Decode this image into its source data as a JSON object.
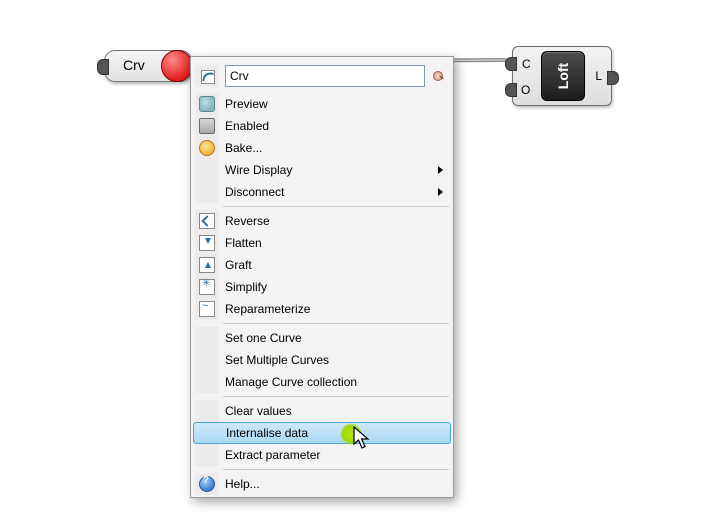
{
  "canvas": {
    "crv_param": {
      "label": "Crv",
      "state": "error"
    },
    "loft": {
      "label": "Loft",
      "inputs": [
        "C",
        "O"
      ],
      "outputs": [
        "L"
      ]
    }
  },
  "context_menu": {
    "name_field": "Crv",
    "sections": [
      {
        "items": [
          {
            "id": "preview",
            "label": "Preview",
            "icon": "preview-icon"
          },
          {
            "id": "enabled",
            "label": "Enabled",
            "icon": "enabled-icon"
          },
          {
            "id": "bake",
            "label": "Bake...",
            "icon": "bake-icon"
          },
          {
            "id": "wiredisp",
            "label": "Wire Display",
            "submenu": true
          },
          {
            "id": "disconnect",
            "label": "Disconnect",
            "submenu": true
          }
        ]
      },
      {
        "items": [
          {
            "id": "reverse",
            "label": "Reverse",
            "icon": "reverse-icon"
          },
          {
            "id": "flatten",
            "label": "Flatten",
            "icon": "flatten-icon"
          },
          {
            "id": "graft",
            "label": "Graft",
            "icon": "graft-icon"
          },
          {
            "id": "simplify",
            "label": "Simplify",
            "icon": "simplify-icon"
          },
          {
            "id": "reparam",
            "label": "Reparameterize",
            "icon": "reparam-icon"
          }
        ]
      },
      {
        "items": [
          {
            "id": "setone",
            "label": "Set one Curve"
          },
          {
            "id": "setmulti",
            "label": "Set Multiple Curves"
          },
          {
            "id": "manage",
            "label": "Manage Curve collection"
          }
        ]
      },
      {
        "items": [
          {
            "id": "clear",
            "label": "Clear values"
          },
          {
            "id": "internal",
            "label": "Internalise data",
            "highlight": true
          },
          {
            "id": "extract",
            "label": "Extract parameter"
          }
        ]
      },
      {
        "items": [
          {
            "id": "help",
            "label": "Help...",
            "icon": "help-icon"
          }
        ]
      }
    ]
  }
}
